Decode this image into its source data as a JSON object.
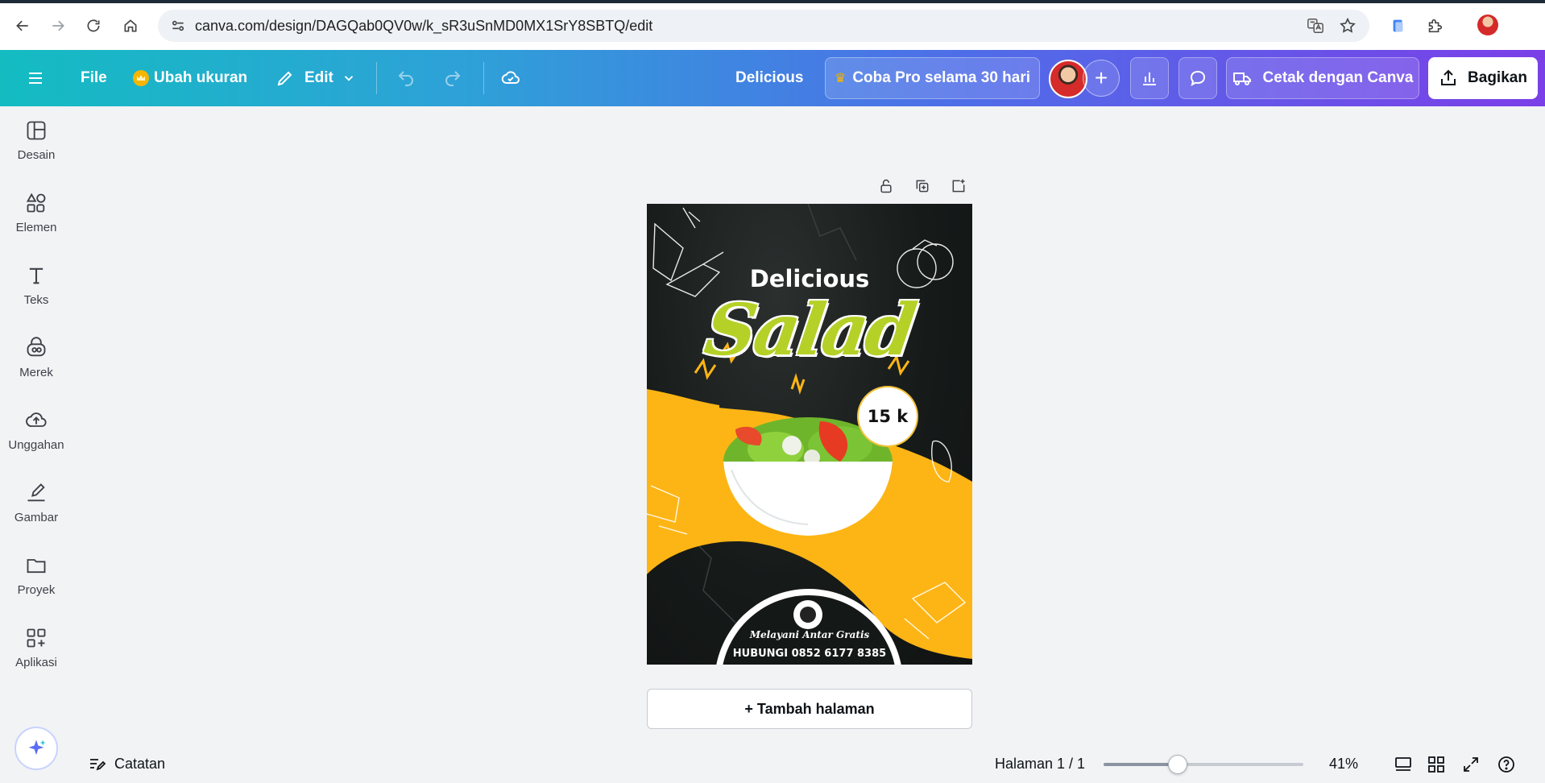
{
  "browser": {
    "url": "canva.com/design/DAGQab0QV0w/k_sR3uSnMD0MX1SrY8SBTQ/edit",
    "icons": [
      "back-icon",
      "forward-icon",
      "reload-icon",
      "home-icon",
      "site-info-icon",
      "translate-icon",
      "bookmark-star-icon",
      "extension-icon",
      "puzzle-icon",
      "profile-avatar"
    ]
  },
  "toolbar": {
    "menu_icon": "hamburger-icon",
    "file_label": "File",
    "resize_label": "Ubah ukuran",
    "edit_label": "Edit",
    "design_title": "Delicious",
    "try_pro_label": "Coba Pro selama 30 hari",
    "print_label": "Cetak dengan Canva",
    "share_label": "Bagikan",
    "colors": {
      "gradient_start": "#14bcc2",
      "gradient_end": "#7b3fe8",
      "crown": "#f7b500"
    }
  },
  "sidebar": {
    "items": [
      {
        "label": "Desain",
        "icon": "design-layout-icon"
      },
      {
        "label": "Elemen",
        "icon": "elements-shapes-icon"
      },
      {
        "label": "Teks",
        "icon": "text-T-icon"
      },
      {
        "label": "Merek",
        "icon": "brand-icon"
      },
      {
        "label": "Unggahan",
        "icon": "cloud-upload-icon"
      },
      {
        "label": "Gambar",
        "icon": "draw-pen-icon"
      },
      {
        "label": "Proyek",
        "icon": "folder-icon"
      },
      {
        "label": "Aplikasi",
        "icon": "apps-grid-icon"
      }
    ]
  },
  "canvas": {
    "page_tools": [
      "lock-icon",
      "duplicate-icon",
      "add-page-icon"
    ],
    "design": {
      "heading": "Delicious",
      "subheading": "Salad",
      "price": "15 k",
      "tagline": "Melayani Antar Gratis",
      "contact": "HUBUNGI 0852 6177 8385",
      "colors": {
        "background": "#161a19",
        "accent_yellow": "#fdb515",
        "salad_green": "#b5d128"
      }
    },
    "add_page_label": "+ Tambah halaman"
  },
  "footer": {
    "notes_label": "Catatan",
    "page_indicator": "Halaman 1 / 1",
    "zoom_label": "41%",
    "zoom_fraction": 0.41
  }
}
